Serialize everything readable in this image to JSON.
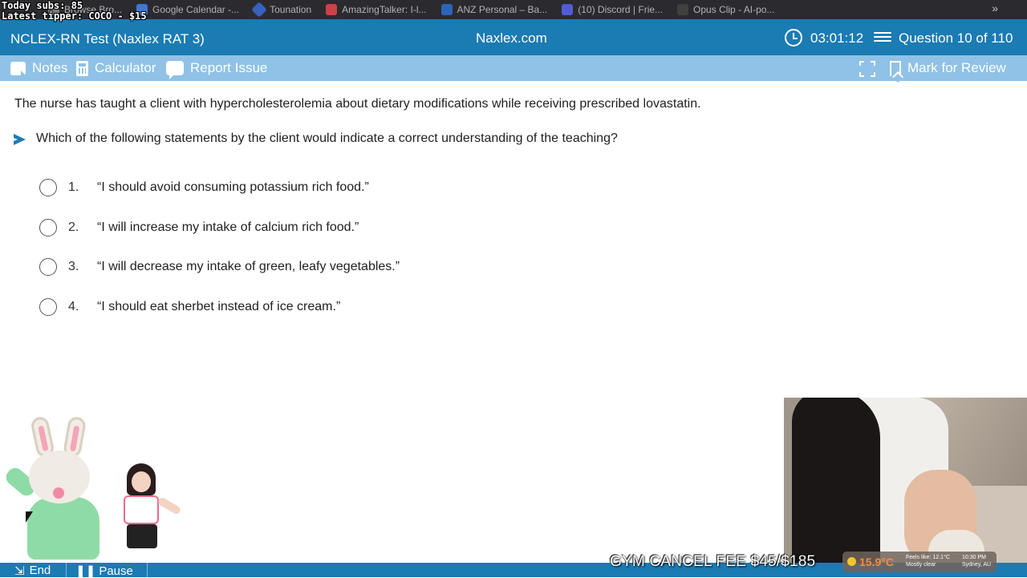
{
  "browser": {
    "bookmarks": [
      {
        "label": "Browse Bro...",
        "color": "#8a8a8a"
      },
      {
        "label": "Google Calendar -...",
        "color": "#4285f4"
      },
      {
        "label": "Tounation",
        "color": "#3b6bd6"
      },
      {
        "label": "AmazingTalker: I-l...",
        "color": "#e5484d"
      },
      {
        "label": "ANZ Personal – Ba...",
        "color": "#2f6fd1"
      },
      {
        "label": "(10) Discord | Frie...",
        "color": "#5865f2"
      },
      {
        "label": "Opus Clip - AI-po...",
        "color": "#444444"
      }
    ],
    "more": "»"
  },
  "overlay": {
    "subs": "Today subs: 85",
    "tipper": "Latest tipper: COCO - $15",
    "gym_fee": "GYM CANCEL FEE $45/$185"
  },
  "header": {
    "test_title": "NCLEX-RN Test (Naxlex RAT 3)",
    "site": "Naxlex.com",
    "timer": "03:01:12",
    "question_count": "Question 10 of 110"
  },
  "toolbar": {
    "notes": "Notes",
    "calculator": "Calculator",
    "report": "Report Issue",
    "mark": "Mark for Review"
  },
  "question": {
    "stem": "The nurse has taught a client with hypercholesterolemia about dietary modifications while receiving prescribed lovastatin.",
    "prompt": "Which of the following statements by the client would indicate a correct understanding of the teaching?",
    "options": [
      {
        "number": "1.",
        "text": "“I should avoid consuming potassium rich food.”"
      },
      {
        "number": "2.",
        "text": "“I will increase my intake of calcium rich food.”"
      },
      {
        "number": "3.",
        "text": "“I will decrease my intake of green, leafy vegetables.”"
      },
      {
        "number": "4.",
        "text": "“I should eat sherbet instead of ice cream.”"
      }
    ]
  },
  "bottom_nav": {
    "end": "End",
    "pause": "Pause"
  },
  "weather": {
    "temp": "15.9°C",
    "feels": "Feels like: 12.1°C",
    "condition": "Mostly clear",
    "time": "10:30 PM",
    "location": "Sydney, AU"
  },
  "colors": {
    "header": "#1b7bb3",
    "toolbar": "#8fc2e6"
  }
}
